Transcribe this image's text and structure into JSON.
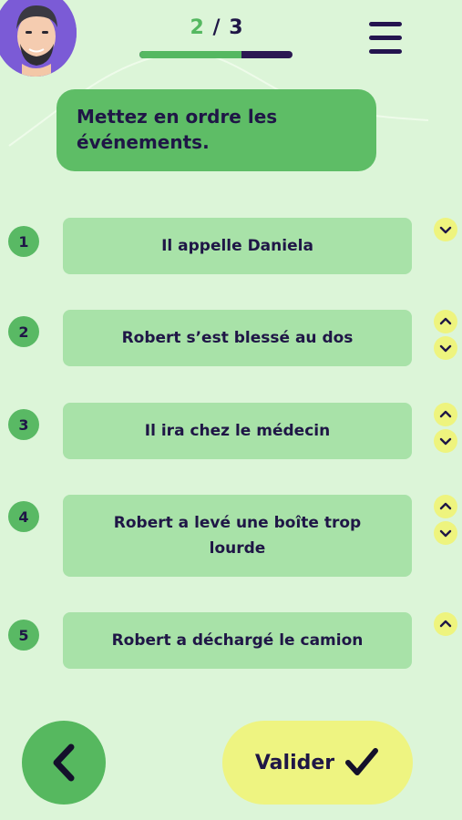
{
  "header": {
    "progress": {
      "current": "2",
      "separator": "/",
      "total": "3",
      "fraction": 0.667
    }
  },
  "instruction": "Mettez en ordre les événements.",
  "items": [
    {
      "number": "1",
      "text": "Il appelle Daniela"
    },
    {
      "number": "2",
      "text": "Robert s’est blessé au dos"
    },
    {
      "number": "3",
      "text": "Il ira chez le médecin"
    },
    {
      "number": "4",
      "text": "Robert a levé une boîte trop lourde"
    },
    {
      "number": "5",
      "text": "Robert a déchargé le camion"
    }
  ],
  "footer": {
    "validate_label": "Valider"
  },
  "colors": {
    "background": "#dcf5d8",
    "accent_green": "#5ebd66",
    "card_green": "#a8e2a8",
    "arrow_yellow": "#eef47e",
    "validate_yellow": "#eef481",
    "navy_text": "#1f1646",
    "avatar_purple": "#7b5bd6"
  },
  "icons": [
    "menu-icon",
    "chevron-up-icon",
    "chevron-down-icon",
    "chevron-left-icon",
    "check-icon",
    "avatar-icon"
  ]
}
